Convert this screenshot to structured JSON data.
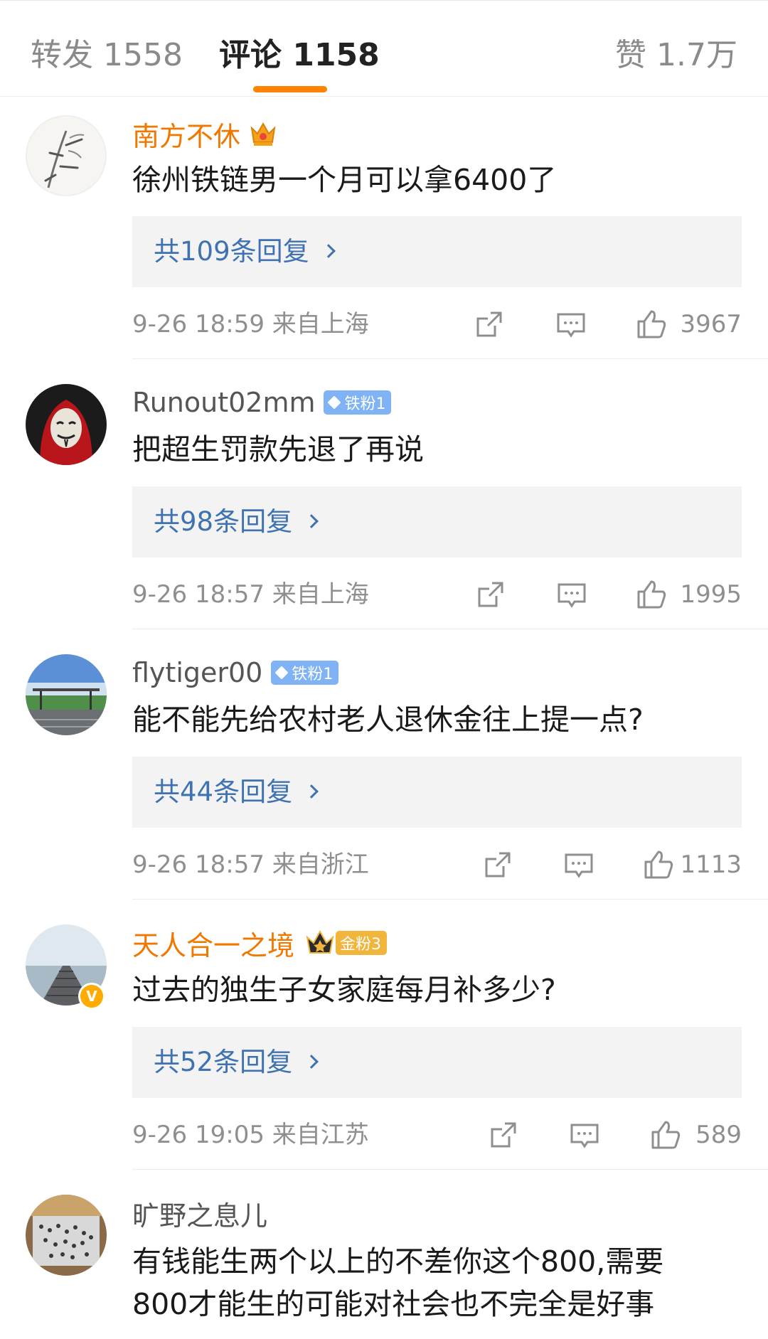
{
  "tabs": {
    "repost_label": "转发",
    "repost_count": "1558",
    "comments_label": "评论",
    "comments_count": "1158",
    "likes_label": "赞",
    "likes_count": "1.7万",
    "active_tab": "comments",
    "accent_color": "#ff8200"
  },
  "comments": [
    {
      "username": "南方不休",
      "username_color": "orange",
      "crown": true,
      "badge": "",
      "text": "徐州铁链男一个月可以拿6400了",
      "replies": "共109条回复",
      "time": "9-26 18:59",
      "location": "来自上海",
      "likes": "3967"
    },
    {
      "username": "Runout02mm",
      "username_color": "gray",
      "badge": "铁粉1",
      "text": "把超生罚款先退了再说",
      "replies": "共98条回复",
      "time": "9-26 18:57",
      "location": "来自上海",
      "likes": "1995"
    },
    {
      "username": "flytiger00",
      "username_color": "gray",
      "badge": "铁粉1",
      "text": "能不能先给农村老人退休金往上提一点?",
      "replies": "共44条回复",
      "time": "9-26 18:57",
      "location": "来自浙江",
      "likes": "1113"
    },
    {
      "username": "天人合一之境",
      "username_color": "orange",
      "badge": "金粉3",
      "verified": true,
      "text": "过去的独生子女家庭每月补多少?",
      "replies": "共52条回复",
      "time": "9-26 19:05",
      "location": "来自江苏",
      "likes": "589"
    },
    {
      "username": "旷野之息儿",
      "username_color": "gray",
      "text_line1": "有钱能生两个以上的不差你这个800,需要",
      "text_line2": "800才能生的可能对社会也不完全是好事"
    }
  ]
}
